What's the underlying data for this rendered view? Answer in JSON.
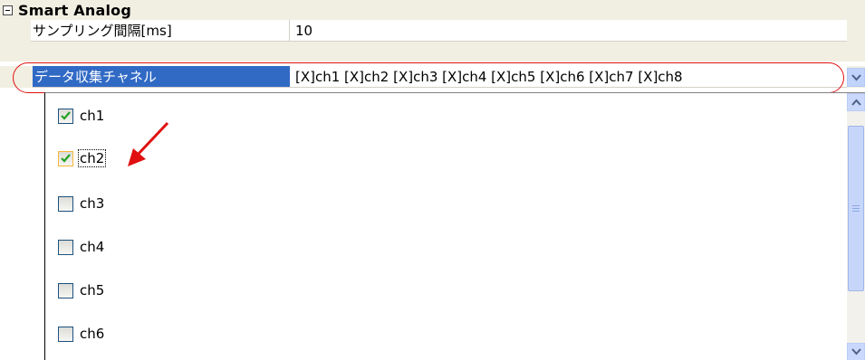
{
  "category": {
    "title": "Smart Analog",
    "expander": "minus-box-icon"
  },
  "properties": [
    {
      "name": "サンプリング間隔[ms]",
      "value": "10"
    },
    {
      "name": "データ収集チャネル",
      "value": "[X]ch1  [X]ch2  [X]ch3  [X]ch4  [X]ch5  [X]ch6  [X]ch7  [X]ch8"
    }
  ],
  "dropdown_items": [
    {
      "label": "ch1",
      "checked": true
    },
    {
      "label": "ch2",
      "checked": true
    },
    {
      "label": "ch3",
      "checked": false
    },
    {
      "label": "ch4",
      "checked": false
    },
    {
      "label": "ch5",
      "checked": false
    },
    {
      "label": "ch6",
      "checked": false
    }
  ],
  "colors": {
    "selection": "#316ac5",
    "annotation": "#e01010",
    "checkmark": "#21a121"
  }
}
